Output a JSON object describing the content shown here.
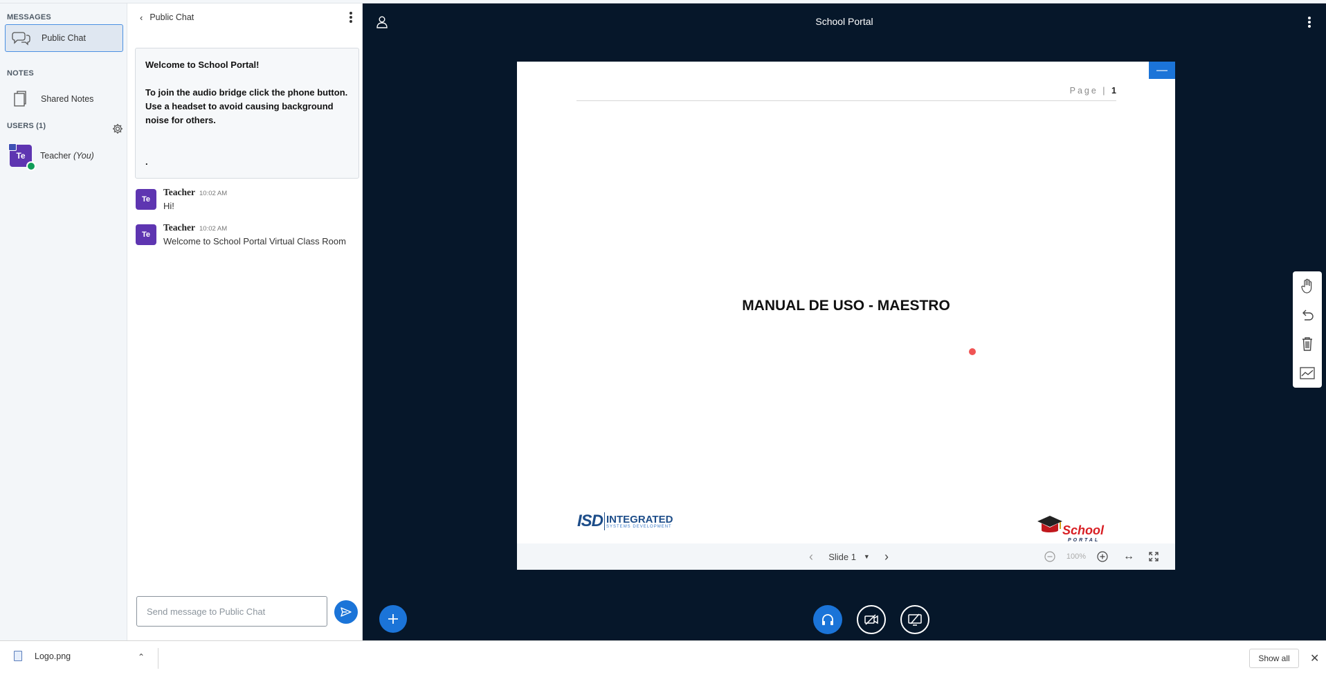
{
  "sidebar": {
    "messages_title": "MESSAGES",
    "public_chat_label": "Public Chat",
    "notes_title": "NOTES",
    "shared_notes_label": "Shared Notes",
    "users_title": "USERS (1)",
    "user": {
      "avatar": "Te",
      "name": "Teacher",
      "you_label": "(You)"
    }
  },
  "chat": {
    "header_title": "Public Chat",
    "welcome": {
      "line1": "Welcome to School Portal!",
      "line2": "To join the audio bridge click the phone button. Use a headset to avoid causing background noise for others.",
      "line3": "."
    },
    "messages": [
      {
        "avatar": "Te",
        "name": "Teacher",
        "time": "10:02 AM",
        "text": "Hi!"
      },
      {
        "avatar": "Te",
        "name": "Teacher",
        "time": "10:02 AM",
        "text": "Welcome to School Portal Virtual Class Room"
      }
    ],
    "input_placeholder": "Send message to Public Chat"
  },
  "main": {
    "title": "School Portal",
    "slide": {
      "page_label": "Page |",
      "page_number": "1",
      "title": "MANUAL DE USO - MAESTRO",
      "logo_left_main": "ISD",
      "logo_left_name": "INTEGRATED",
      "logo_left_sub": "SYSTEMS DEVELOPMENT",
      "logo_right_top": "School",
      "logo_right_bottom": "PORTAL"
    },
    "toolbar": {
      "slide_label": "Slide 1",
      "zoom": "100%"
    }
  },
  "downloads": {
    "file_name": "Logo.png",
    "show_all_label": "Show all"
  },
  "colors": {
    "accent": "#1b74d8",
    "main_bg": "#06172a",
    "avatar": "#5e35b1"
  }
}
